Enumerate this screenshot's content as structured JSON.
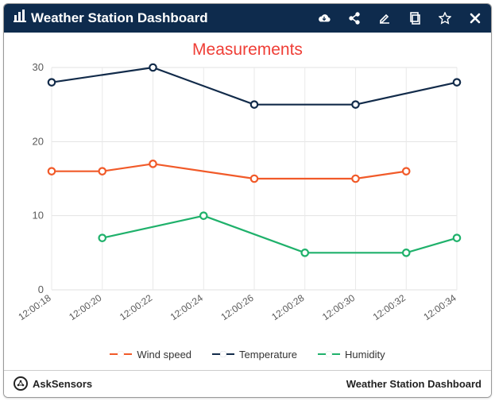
{
  "header": {
    "title": "Weather Station Dashboard",
    "icons": [
      "cloud-download-icon",
      "share-icon",
      "edit-icon",
      "copy-icon",
      "star-icon",
      "close-icon"
    ]
  },
  "footer": {
    "brand": "AskSensors",
    "right": "Weather Station Dashboard"
  },
  "chart_data": {
    "type": "line",
    "title": "Measurements",
    "xlabel": "",
    "ylabel": "",
    "ylim": [
      0,
      30
    ],
    "yticks": [
      0,
      10,
      20,
      30
    ],
    "categories": [
      "12:00:18",
      "12:00:20",
      "12:00:22",
      "12:00:24",
      "12:00:26",
      "12:00:28",
      "12:00:30",
      "12:00:32",
      "12:00:34"
    ],
    "series": [
      {
        "name": "Wind speed",
        "color": "#f15a29",
        "values": [
          16,
          16,
          17,
          null,
          15,
          null,
          15,
          16,
          null
        ]
      },
      {
        "name": "Temperature",
        "color": "#122b4a",
        "values": [
          28,
          null,
          30,
          null,
          25,
          null,
          25,
          null,
          28
        ]
      },
      {
        "name": "Humidity",
        "color": "#1fb16b",
        "values": [
          null,
          7,
          null,
          10,
          null,
          5,
          null,
          5,
          7
        ]
      }
    ],
    "legend_position": "bottom",
    "grid": true
  }
}
